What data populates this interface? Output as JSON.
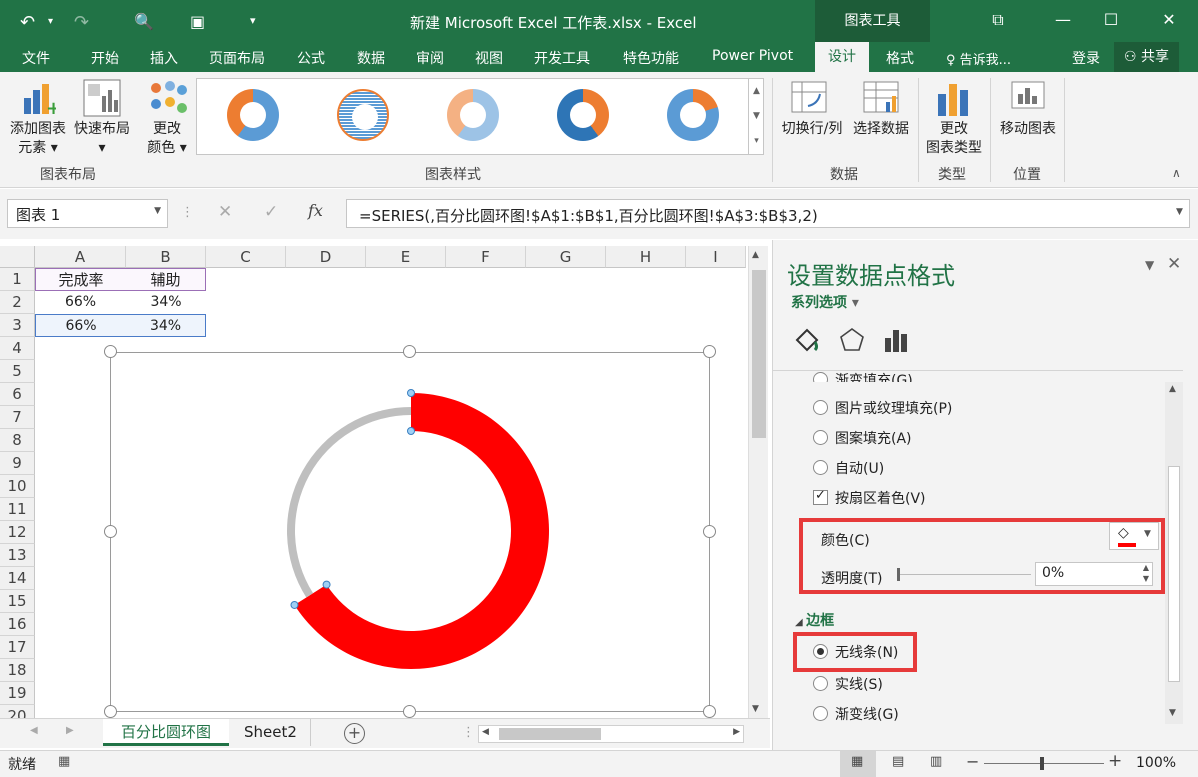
{
  "window": {
    "title": "新建 Microsoft Excel 工作表.xlsx - Excel",
    "context_group": "图表工具"
  },
  "tabs": [
    "文件",
    "开始",
    "插入",
    "页面布局",
    "公式",
    "数据",
    "审阅",
    "视图",
    "开发工具",
    "特色功能",
    "Power Pivot",
    "设计",
    "格式"
  ],
  "active_tab": "设计",
  "tell_me": "告诉我...",
  "login": "登录",
  "share": "共享",
  "ribbon": {
    "add_element": "添加图表元素",
    "add_element_l1": "添加图表",
    "add_element_l2": "元素",
    "quick_layout": "快速布局",
    "change_colors_l1": "更改",
    "change_colors_l2": "颜色",
    "group_layout": "图表布局",
    "group_styles": "图表样式",
    "switch_rowcol": "切换行/列",
    "select_data": "选择数据",
    "group_data": "数据",
    "change_type_l1": "更改",
    "change_type_l2": "图表类型",
    "group_type": "类型",
    "move_chart": "移动图表",
    "group_location": "位置"
  },
  "formula_bar": {
    "name_box": "图表 1",
    "fx": "fx",
    "formula": "=SERIES(,百分比圆环图!$A$1:$B$1,百分比圆环图!$A$3:$B$3,2)"
  },
  "columns": [
    "A",
    "B",
    "C",
    "D",
    "E",
    "F",
    "G",
    "H",
    "I"
  ],
  "rows": [
    "1",
    "2",
    "3",
    "4",
    "5",
    "6",
    "7",
    "8",
    "9",
    "10",
    "11",
    "12",
    "13",
    "14",
    "15",
    "16",
    "17",
    "18",
    "19",
    "20"
  ],
  "cells": {
    "a1": "完成率",
    "b1": "辅助",
    "a2": "66%",
    "b2": "34%",
    "a3": "66%",
    "b3": "34%"
  },
  "chart_data": {
    "type": "pie",
    "labels": [
      "完成率",
      "辅助"
    ],
    "values": [
      66,
      34
    ],
    "colors": [
      "#ff0000",
      "#bfbfbf"
    ]
  },
  "pane": {
    "title": "设置数据点格式",
    "series_options": "系列选项",
    "fill_options": [
      {
        "label": "渐变填充(G)",
        "type": "radio",
        "checked": false
      },
      {
        "label": "图片或纹理填充(P)",
        "type": "radio",
        "checked": false
      },
      {
        "label": "图案填充(A)",
        "type": "radio",
        "checked": false
      },
      {
        "label": "自动(U)",
        "type": "radio",
        "checked": false
      },
      {
        "label": "按扇区着色(V)",
        "type": "checkbox",
        "checked": true
      }
    ],
    "color_label": "颜色(C)",
    "fill_color": "#ff0000",
    "transparency_label": "透明度(T)",
    "transparency_value": "0%",
    "border_header": "边框",
    "border_options": [
      {
        "label": "无线条(N)",
        "checked": true
      },
      {
        "label": "实线(S)",
        "checked": false
      },
      {
        "label": "渐变线(G)",
        "checked": false
      }
    ]
  },
  "sheet_tabs": [
    "百分比圆环图",
    "Sheet2"
  ],
  "status": {
    "ready": "就绪",
    "zoom": "100%"
  },
  "theme": {
    "green": "#217346",
    "highlight": "#e63a3a"
  }
}
